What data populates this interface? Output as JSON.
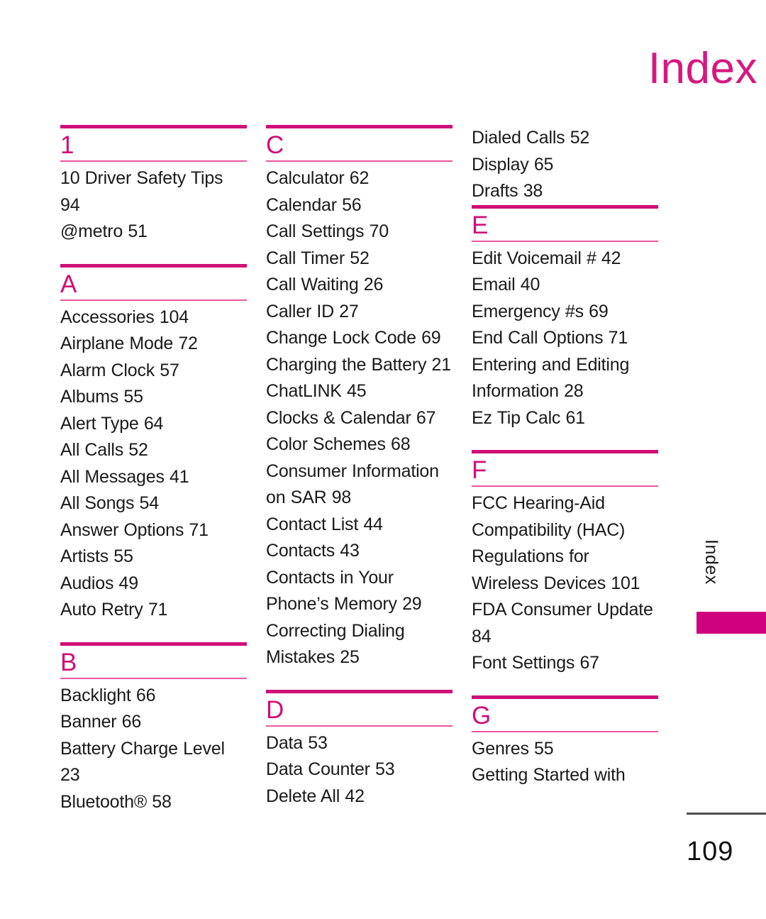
{
  "header": {
    "title": "Index",
    "title_color": "#d6187f"
  },
  "side_tab": {
    "label": "Index",
    "block_color": "#d0017d"
  },
  "footer": {
    "page_number": "109"
  },
  "theme": {
    "accent": "#cf0f77",
    "accent_light": "#e8589f",
    "text": "#1a1a1a"
  },
  "columns": [
    {
      "id": "column-1",
      "sections": [
        {
          "letter": "1",
          "entries": [
            "10 Driver Safety Tips 94",
            "@metro 51"
          ]
        },
        {
          "letter": "A",
          "entries": [
            "Accessories 104",
            "Airplane Mode 72",
            "Alarm Clock 57",
            "Albums 55",
            "Alert Type 64",
            "All Calls 52",
            "All Messages 41",
            "All Songs 54",
            "Answer Options 71",
            "Artists 55",
            "Audios 49",
            "Auto Retry 71"
          ]
        },
        {
          "letter": "B",
          "entries": [
            "Backlight 66",
            "Banner 66",
            "Battery Charge Level 23",
            "Bluetooth® 58"
          ]
        }
      ]
    },
    {
      "id": "column-2",
      "sections": [
        {
          "letter": "C",
          "entries": [
            "Calculator 62",
            "Calendar 56",
            "Call Settings 70",
            "Call Timer 52",
            "Call Waiting 26",
            "Caller ID 27",
            "Change Lock Code 69",
            "Charging the Battery 21",
            "ChatLINK 45",
            "Clocks & Calendar 67",
            "Color Schemes 68",
            "Consumer Information on SAR 98",
            "Contact List 44",
            "Contacts 43",
            "Contacts in Your Phone’s Memory 29",
            "Correcting Dialing Mistakes 25"
          ]
        },
        {
          "letter": "D",
          "entries": [
            "Data 53",
            "Data Counter 53",
            "Delete All 42"
          ]
        }
      ]
    },
    {
      "id": "column-3",
      "continuation_entries": [
        "Dialed Calls 52",
        "Display 65",
        "Drafts 38"
      ],
      "sections": [
        {
          "letter": "E",
          "entries": [
            "Edit Voicemail # 42",
            "Email 40",
            "Emergency #s 69",
            "End Call Options 71",
            "Entering and Editing Information 28",
            "Ez Tip Calc 61"
          ]
        },
        {
          "letter": "F",
          "entries": [
            "FCC Hearing-Aid Compatibility (HAC) Regulations for Wireless Devices 101",
            "FDA Consumer Update 84",
            "Font Settings 67"
          ]
        },
        {
          "letter": "G",
          "entries": [
            "Genres 55",
            "Getting Started with"
          ]
        }
      ]
    }
  ]
}
